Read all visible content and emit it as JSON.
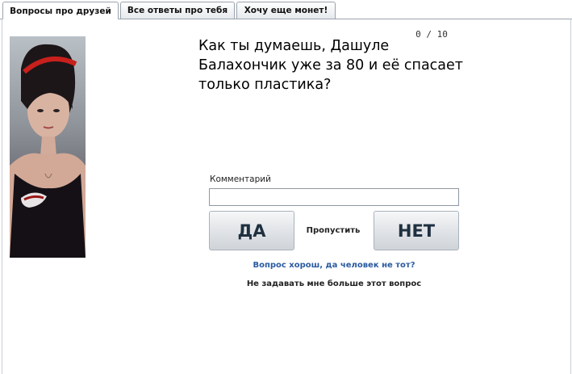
{
  "tabs": [
    {
      "label": "Вопросы про друзей",
      "active": true
    },
    {
      "label": "Все ответы про тебя",
      "active": false
    },
    {
      "label": "Хочу еще монет!",
      "active": false
    }
  ],
  "quiz": {
    "counter": "0 / 10",
    "question": "Как ты думаешь, Дашуле Балахончик уже за 80 и её спасает только пластика?",
    "comment_label": "Комментарий",
    "comment_value": "",
    "yes_label": "ДА",
    "skip_label": "Пропустить",
    "no_label": "НЕТ",
    "wrong_person_link": "Вопрос хорош, да человек не тот?",
    "never_ask_link": "Не задавать мне больше этот вопрос"
  },
  "colors": {
    "link_blue": "#2a5aa0",
    "button_text": "#1f3040",
    "tab_border": "#9aa3ad"
  }
}
